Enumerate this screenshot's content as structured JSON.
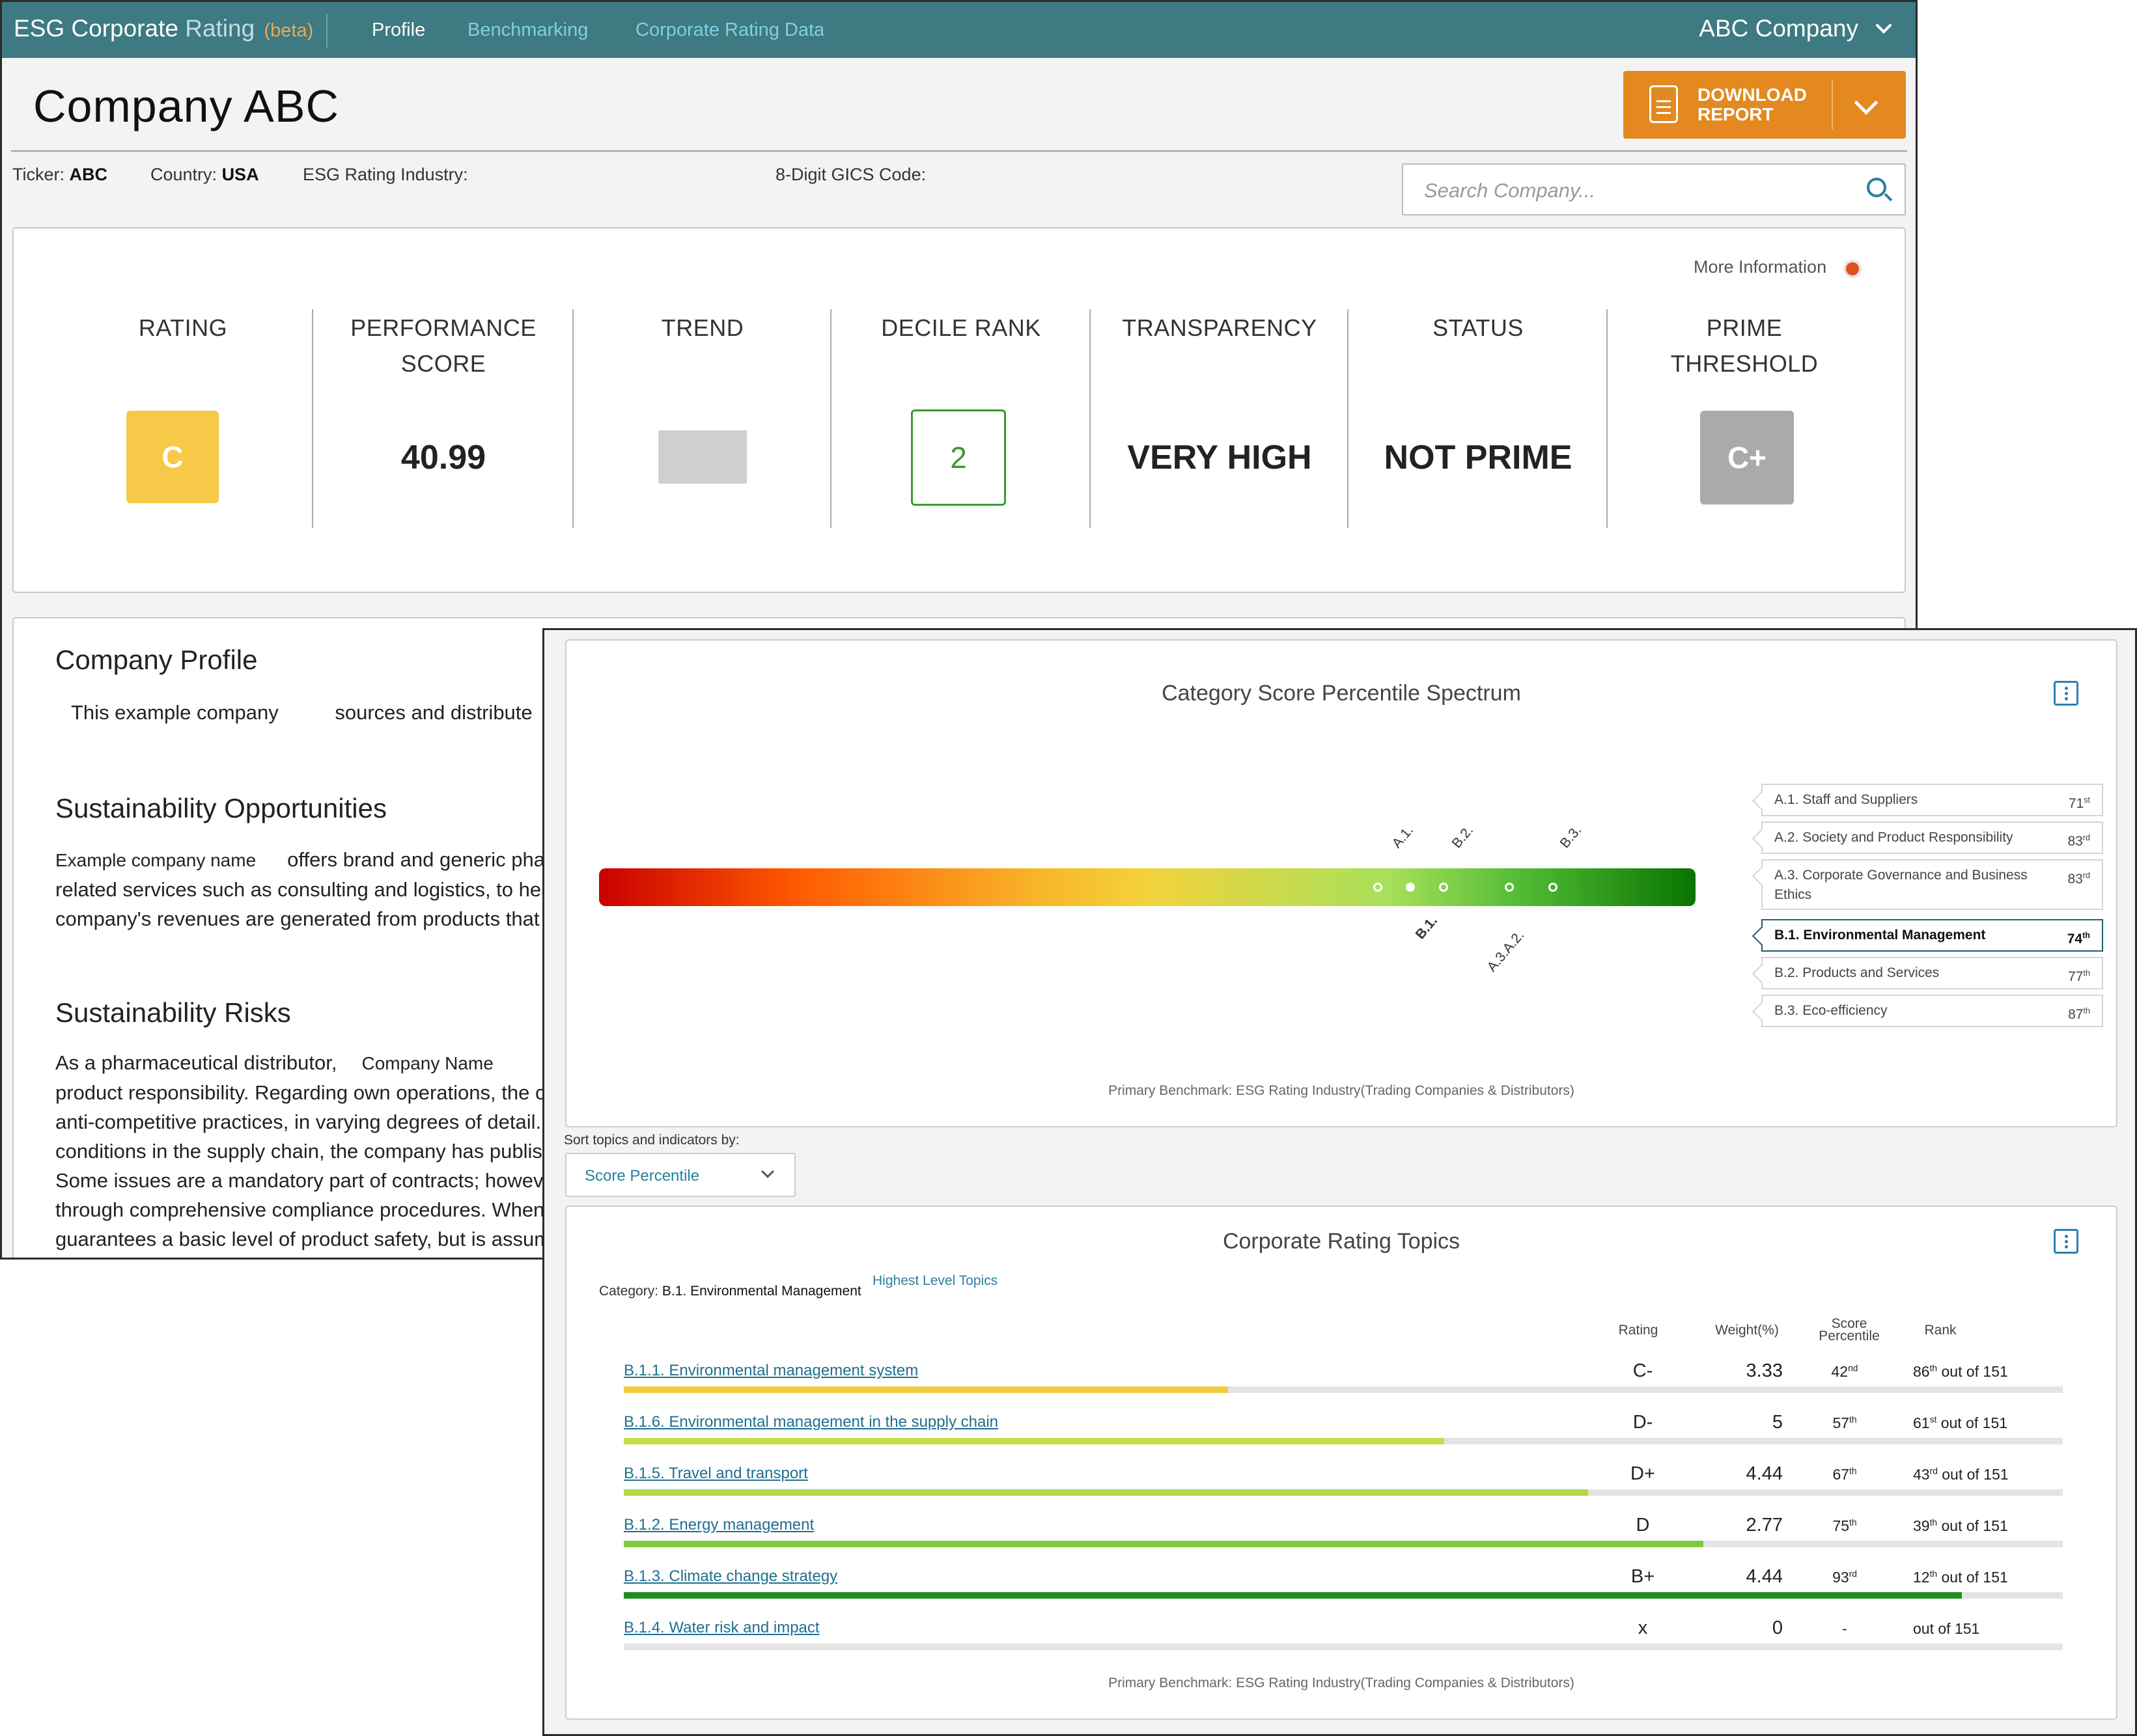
{
  "app": {
    "brand_main": "ESG Corporate",
    "brand_sub": "Rating",
    "brand_tag": "(beta)",
    "nav": [
      "Profile",
      "Benchmarking",
      "Corporate Rating Data"
    ],
    "company_selector": "ABC Company"
  },
  "page": {
    "title": "Company ABC",
    "download": {
      "line1": "DOWNLOAD",
      "line2": "REPORT"
    },
    "info": {
      "ticker_label": "Ticker:",
      "ticker": "ABC",
      "country_label": "Country:",
      "country": "USA",
      "industry_label": "ESG Rating Industry:",
      "gics_label": "8-Digit GICS Code:"
    },
    "search_placeholder": "Search Company..."
  },
  "metrics": {
    "more_info": "More Information",
    "rating": {
      "label": "RATING",
      "value": "C",
      "color": "#f7c948"
    },
    "performance": {
      "label1": "PERFORMANCE",
      "label2": "SCORE",
      "value": "40.99"
    },
    "trend": {
      "label": "TREND"
    },
    "decile": {
      "label": "DECILE RANK",
      "value": "2",
      "color": "#3a9a2f"
    },
    "transparency": {
      "label": "TRANSPARENCY",
      "value": "VERY HIGH"
    },
    "status": {
      "label": "STATUS",
      "value": "NOT PRIME"
    },
    "prime": {
      "label1": "PRIME",
      "label2": "THRESHOLD",
      "value": "C+",
      "color": "#aaaaaa"
    }
  },
  "profile": {
    "h1": "Company Profile",
    "p1a": "This example company",
    "p1b": "sources and distribute",
    "h2": "Sustainability Opportunities",
    "p2": [
      "Example company name",
      "offers brand and generic pha",
      "related services such as consulting and logistics, to hea",
      "company's revenues are generated from products that"
    ],
    "h3": "Sustainability Risks",
    "p3": [
      "As a pharmaceutical distributor,",
      "Company Name",
      "product responsibility. Regarding own operations, the c",
      "anti-competitive practices, in varying degrees of detail.",
      "conditions in the supply chain, the company has publish",
      "Some issues are a mandatory part of contracts; howeve",
      "through comprehensive compliance procedures. When",
      "guarantees a basic level of product safety, but is assum"
    ]
  },
  "spectrum": {
    "title": "Category Score Percentile Spectrum",
    "above_labels": [
      "A.1.",
      "B.2.",
      "B.3."
    ],
    "below_labels": [
      "B.1.",
      "A.3.A.2."
    ],
    "points": [
      71,
      74,
      77,
      83,
      87
    ],
    "legend": [
      {
        "name": "A.1. Staff and Suppliers",
        "pct": "71",
        "suf": "st"
      },
      {
        "name": "A.2. Society and Product Responsibility",
        "pct": "83",
        "suf": "rd"
      },
      {
        "name": "A.3. Corporate Governance and Business",
        "name2": "Ethics",
        "pct": "83",
        "suf": "rd"
      },
      {
        "name": "B.1. Environmental Management",
        "pct": "74",
        "suf": "th"
      },
      {
        "name": "B.2. Products and Services",
        "pct": "77",
        "suf": "th"
      },
      {
        "name": "B.3. Eco-efficiency",
        "pct": "87",
        "suf": "th"
      }
    ],
    "footnote": "Primary Benchmark: ESG Rating Industry(Trading Companies & Distributors)"
  },
  "sort": {
    "label": "Sort topics and indicators by:",
    "value": "Score Percentile"
  },
  "topics": {
    "title": "Corporate Rating Topics",
    "category_label": "Category:",
    "category_value": "B.1. Environmental Management",
    "highest_link": "Highest Level Topics",
    "col_rating": "Rating",
    "col_weight": "Weight(%)",
    "col_score1": "Score",
    "col_score2": "Percentile",
    "col_rank": "Rank",
    "rows": [
      {
        "name": "B.1.1. Environmental management system",
        "rating": "C-",
        "weight": "3.33",
        "pct": "42",
        "suf": "nd",
        "rank": "86",
        "rsuf": "th",
        "of": "out of 151",
        "fill": 0.42,
        "color": "#f2cc3c"
      },
      {
        "name": "B.1.6. Environmental management in the supply chain",
        "rating": "D-",
        "weight": "5",
        "pct": "57",
        "suf": "th",
        "rank": "61",
        "rsuf": "st",
        "of": "out of 151",
        "fill": 0.57,
        "color": "#c9db4a"
      },
      {
        "name": "B.1.5. Travel and transport",
        "rating": "D+",
        "weight": "4.44",
        "pct": "67",
        "suf": "th",
        "rank": "43",
        "rsuf": "rd",
        "of": "out of 151",
        "fill": 0.67,
        "color": "#b5d84a"
      },
      {
        "name": "B.1.2. Energy management",
        "rating": "D",
        "weight": "2.77",
        "pct": "75",
        "suf": "th",
        "rank": "39",
        "rsuf": "th",
        "of": "out of 151",
        "fill": 0.75,
        "color": "#7ccb3e"
      },
      {
        "name": "B.1.3. Climate change strategy",
        "rating": "B+",
        "weight": "4.44",
        "pct": "93",
        "suf": "rd",
        "rank": "12",
        "rsuf": "th",
        "of": "out of 151",
        "fill": 0.93,
        "color": "#1f8e1f"
      },
      {
        "name": "B.1.4. Water risk and impact",
        "rating": "x",
        "weight": "0",
        "pct": "-",
        "suf": "",
        "rank": "",
        "rsuf": "",
        "of": "out of 151",
        "fill": 0,
        "color": "#cccccc"
      }
    ],
    "footnote": "Primary Benchmark: ESG Rating Industry(Trading Companies & Distributors)"
  }
}
